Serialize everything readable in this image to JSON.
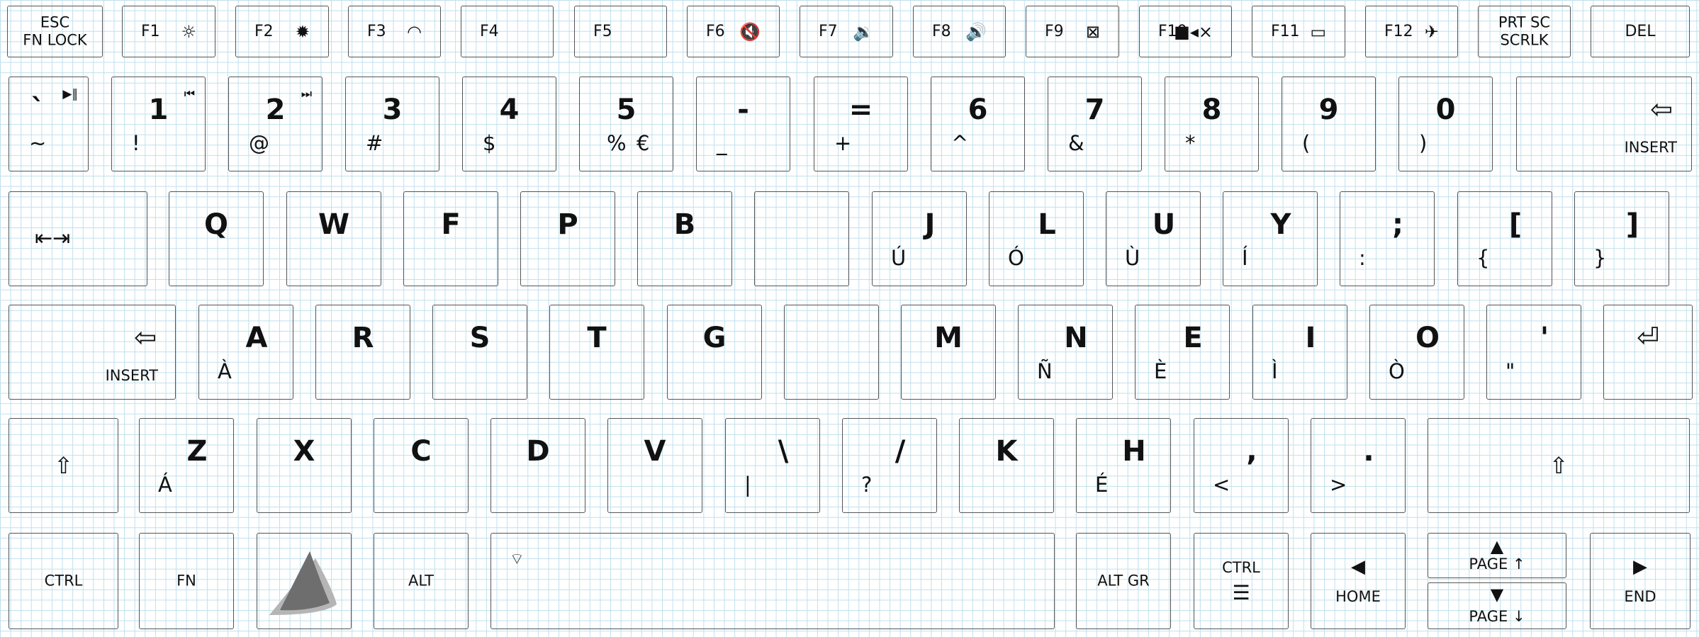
{
  "function_row": [
    {
      "name": "esc",
      "top": "ESC",
      "bottom": "FN LOCK"
    },
    {
      "name": "f1",
      "label": "F1",
      "icon": "brightness-down-icon",
      "glyph": "☼"
    },
    {
      "name": "f2",
      "label": "F2",
      "icon": "brightness-up-icon",
      "glyph": "✹"
    },
    {
      "name": "f3",
      "label": "F3",
      "icon": "performance-gauge-icon",
      "glyph": "◠"
    },
    {
      "name": "f4",
      "label": "F4"
    },
    {
      "name": "f5",
      "label": "F5"
    },
    {
      "name": "f6",
      "label": "F6",
      "icon": "mute-icon",
      "glyph": "🔇"
    },
    {
      "name": "f7",
      "label": "F7",
      "icon": "volume-down-icon",
      "glyph": "🔉"
    },
    {
      "name": "f8",
      "label": "F8",
      "icon": "volume-up-icon",
      "glyph": "🔊"
    },
    {
      "name": "f9",
      "label": "F9",
      "icon": "display-off-icon",
      "glyph": "⊠"
    },
    {
      "name": "f10",
      "label": "F10",
      "icon": "camera-off-icon",
      "glyph": "■◂×"
    },
    {
      "name": "f11",
      "label": "F11",
      "icon": "touchpad-icon",
      "glyph": "▭"
    },
    {
      "name": "f12",
      "label": "F12",
      "icon": "airplane-mode-icon",
      "glyph": "✈"
    },
    {
      "name": "prtsc",
      "top": "PRT SC",
      "bottom": "SCRLK"
    },
    {
      "name": "del",
      "label": "DEL"
    }
  ],
  "number_row": [
    {
      "name": "backtick",
      "main": "`",
      "low": "~",
      "media_icon": "play-pause-icon",
      "media": "▶‖"
    },
    {
      "name": "1",
      "main": "1",
      "low": "!",
      "media_icon": "previous-track-icon",
      "media": "⏮"
    },
    {
      "name": "2",
      "main": "2",
      "low": "@",
      "media_icon": "next-track-icon",
      "media": "⏭"
    },
    {
      "name": "3",
      "main": "3",
      "low": "#"
    },
    {
      "name": "4",
      "main": "4",
      "low": "$"
    },
    {
      "name": "5",
      "main": "5",
      "low": "%",
      "alt": "€"
    },
    {
      "name": "minus",
      "main": "-",
      "low": "_"
    },
    {
      "name": "equals",
      "main": "=",
      "low": "+"
    },
    {
      "name": "6",
      "main": "6",
      "low": "^"
    },
    {
      "name": "7",
      "main": "7",
      "low": "&"
    },
    {
      "name": "8",
      "main": "8",
      "low": "*"
    },
    {
      "name": "9",
      "main": "9",
      "low": "("
    },
    {
      "name": "0",
      "main": "0",
      "low": ")"
    },
    {
      "name": "backspace",
      "icon": "backspace-arrow-icon",
      "glyph": "⇦",
      "word": "INSERT"
    }
  ],
  "top_row": [
    {
      "name": "tab",
      "icon": "tab-arrows-icon",
      "glyph": "⇤⇥"
    },
    {
      "name": "q",
      "main": "Q"
    },
    {
      "name": "w",
      "main": "W"
    },
    {
      "name": "f",
      "main": "F"
    },
    {
      "name": "p",
      "main": "P"
    },
    {
      "name": "b",
      "main": "B"
    },
    {
      "name": "blank1",
      "main": ""
    },
    {
      "name": "j",
      "main": "J",
      "low": "Ú"
    },
    {
      "name": "l",
      "main": "L",
      "low": "Ó"
    },
    {
      "name": "u",
      "main": "U",
      "low": "Ù"
    },
    {
      "name": "y",
      "main": "Y",
      "low": "Í"
    },
    {
      "name": "semicolon",
      "main": ";",
      "low": ":"
    },
    {
      "name": "lbracket",
      "main": "[",
      "low": "{"
    },
    {
      "name": "rbracket",
      "main": "]",
      "low": "}"
    }
  ],
  "home_row": [
    {
      "name": "backspace-left",
      "icon": "backspace-arrow-icon",
      "glyph": "⇦",
      "word": "INSERT"
    },
    {
      "name": "a",
      "main": "A",
      "low": "À"
    },
    {
      "name": "r",
      "main": "R"
    },
    {
      "name": "s",
      "main": "S"
    },
    {
      "name": "t",
      "main": "T"
    },
    {
      "name": "g",
      "main": "G"
    },
    {
      "name": "blank2",
      "main": ""
    },
    {
      "name": "m",
      "main": "M"
    },
    {
      "name": "n",
      "main": "N",
      "low": "Ñ"
    },
    {
      "name": "e",
      "main": "E",
      "low": "È"
    },
    {
      "name": "i",
      "main": "I",
      "low": "Ì"
    },
    {
      "name": "o",
      "main": "O",
      "low": "Ò"
    },
    {
      "name": "quote",
      "main": "'",
      "low": "\""
    },
    {
      "name": "enter",
      "icon": "enter-arrow-icon",
      "glyph": "⏎"
    }
  ],
  "bottom_alpha_row": [
    {
      "name": "lshift",
      "icon": "shift-icon",
      "glyph": "⇧"
    },
    {
      "name": "z",
      "main": "Z",
      "low": "Á"
    },
    {
      "name": "x",
      "main": "X"
    },
    {
      "name": "c",
      "main": "C"
    },
    {
      "name": "d",
      "main": "D"
    },
    {
      "name": "v",
      "main": "V"
    },
    {
      "name": "backslash",
      "main": "\\",
      "low": "|"
    },
    {
      "name": "slash",
      "main": "/",
      "low": "?"
    },
    {
      "name": "k",
      "main": "K"
    },
    {
      "name": "h",
      "main": "H",
      "low": "É"
    },
    {
      "name": "comma",
      "main": ",",
      "low": "<"
    },
    {
      "name": "period",
      "main": ".",
      "low": ">"
    },
    {
      "name": "rshift",
      "icon": "shift-icon",
      "glyph": "⇧"
    }
  ],
  "space_row": [
    {
      "name": "lctrl",
      "label": "CTRL"
    },
    {
      "name": "fn",
      "label": "FN"
    },
    {
      "name": "logo",
      "icon": "brand-logo-icon"
    },
    {
      "name": "alt",
      "label": "ALT"
    },
    {
      "name": "space",
      "icon": "backlight-icon",
      "glyph": "⌔"
    },
    {
      "name": "altgr",
      "label": "ALT GR"
    },
    {
      "name": "rctrl",
      "label": "CTRL",
      "icon": "menu-icon",
      "glyph": "☰"
    },
    {
      "name": "left",
      "glyph": "◀",
      "word": "HOME",
      "icon": "left-arrow-icon"
    },
    {
      "name": "up",
      "glyph": "▲",
      "word": "PAGE ↑",
      "icon": "up-arrow-icon"
    },
    {
      "name": "down",
      "glyph": "▼",
      "word": "PAGE ↓",
      "icon": "down-arrow-icon"
    },
    {
      "name": "right",
      "glyph": "▶",
      "word": "END",
      "icon": "right-arrow-icon"
    }
  ],
  "colors": {
    "grid": "#bfe0ec",
    "key_border": "#555555",
    "logo_dark": "#6e6e6e",
    "logo_light": "#b5b5b5"
  }
}
